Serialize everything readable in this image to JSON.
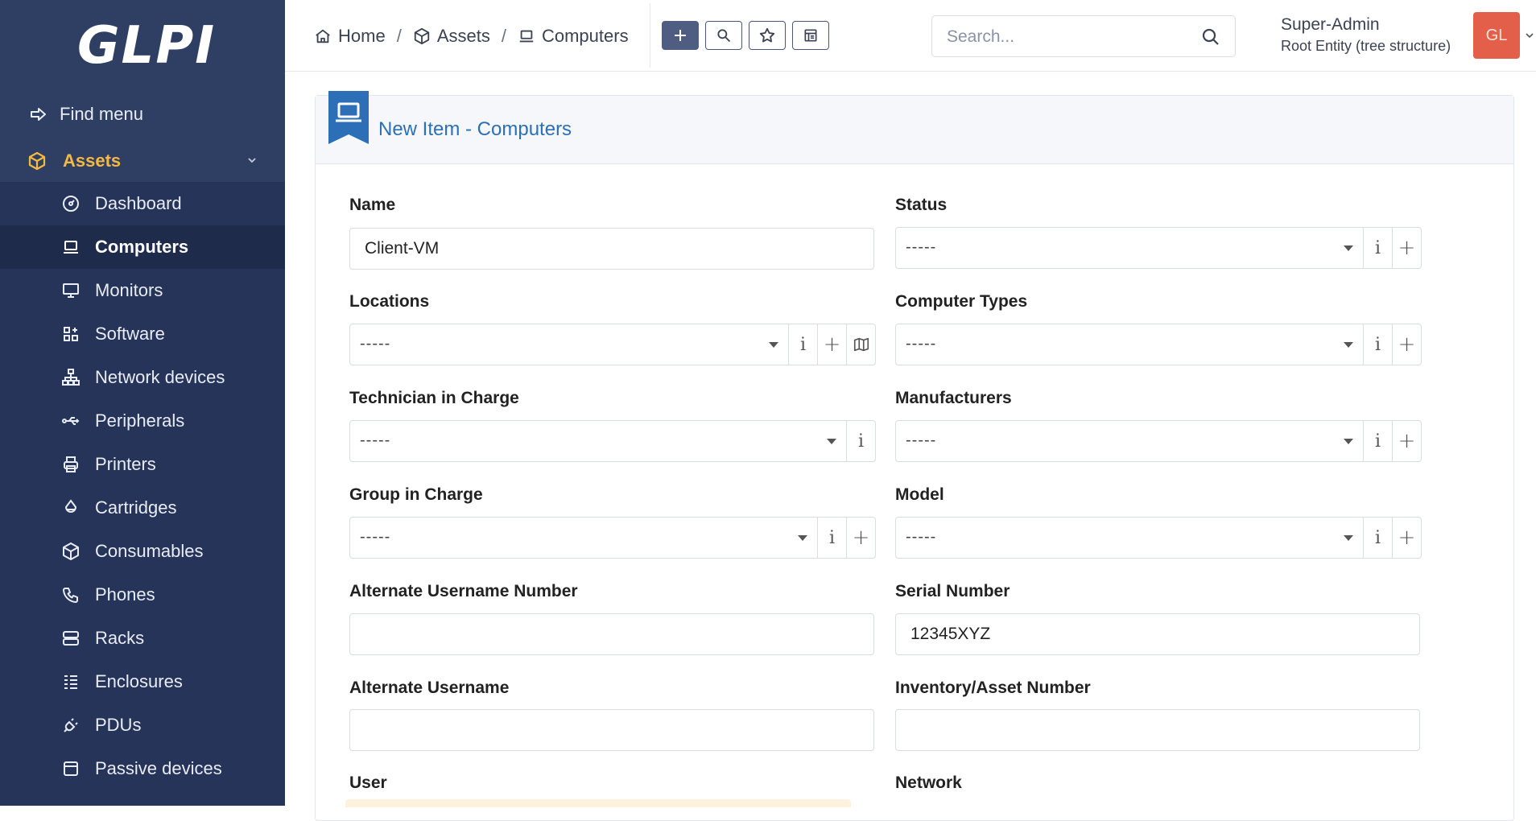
{
  "app": {
    "logo_text": "GLPI"
  },
  "sidebar": {
    "find_menu": "Find menu",
    "section": "Assets",
    "items": [
      {
        "label": "Dashboard",
        "icon": "dashboard-icon"
      },
      {
        "label": "Computers",
        "icon": "laptop-icon",
        "active": true
      },
      {
        "label": "Monitors",
        "icon": "monitor-icon"
      },
      {
        "label": "Software",
        "icon": "apps-icon"
      },
      {
        "label": "Network devices",
        "icon": "network-icon"
      },
      {
        "label": "Peripherals",
        "icon": "usb-icon"
      },
      {
        "label": "Printers",
        "icon": "printer-icon"
      },
      {
        "label": "Cartridges",
        "icon": "droplet-icon"
      },
      {
        "label": "Consumables",
        "icon": "package-icon"
      },
      {
        "label": "Phones",
        "icon": "phone-icon"
      },
      {
        "label": "Racks",
        "icon": "server-icon"
      },
      {
        "label": "Enclosures",
        "icon": "list-icon"
      },
      {
        "label": "PDUs",
        "icon": "plug-icon"
      },
      {
        "label": "Passive devices",
        "icon": "box-icon"
      }
    ]
  },
  "topbar": {
    "breadcrumb": [
      {
        "label": "Home",
        "icon": "home-icon"
      },
      {
        "label": "Assets",
        "icon": "package-icon"
      },
      {
        "label": "Computers",
        "icon": "laptop-icon"
      }
    ],
    "search_placeholder": "Search...",
    "user_name": "Super-Admin",
    "user_entity": "Root Entity (tree structure)",
    "avatar_initials": "GL"
  },
  "form": {
    "title": "New Item - Computers",
    "fields": {
      "name": {
        "label": "Name",
        "value": "Client-VM"
      },
      "status": {
        "label": "Status",
        "value": "-----"
      },
      "locations": {
        "label": "Locations",
        "value": "-----"
      },
      "computer_types": {
        "label": "Computer Types",
        "value": "-----"
      },
      "technician": {
        "label": "Technician in Charge",
        "value": "-----"
      },
      "manufacturers": {
        "label": "Manufacturers",
        "value": "-----"
      },
      "group": {
        "label": "Group in Charge",
        "value": "-----"
      },
      "model": {
        "label": "Model",
        "value": "-----"
      },
      "alt_username_number": {
        "label": "Alternate Username Number",
        "value": ""
      },
      "serial_number": {
        "label": "Serial Number",
        "value": "12345XYZ"
      },
      "alt_username": {
        "label": "Alternate Username",
        "value": ""
      },
      "inventory_number": {
        "label": "Inventory/Asset Number",
        "value": ""
      },
      "user": {
        "label": "User"
      },
      "network": {
        "label": "Network"
      }
    },
    "addon_info": "i",
    "addon_plus": "+"
  },
  "colors": {
    "sidebar_bg": "#2f3f64",
    "accent_assets": "#f5b942",
    "title_blue": "#2c6fb7",
    "avatar_bg": "#e35f49"
  }
}
